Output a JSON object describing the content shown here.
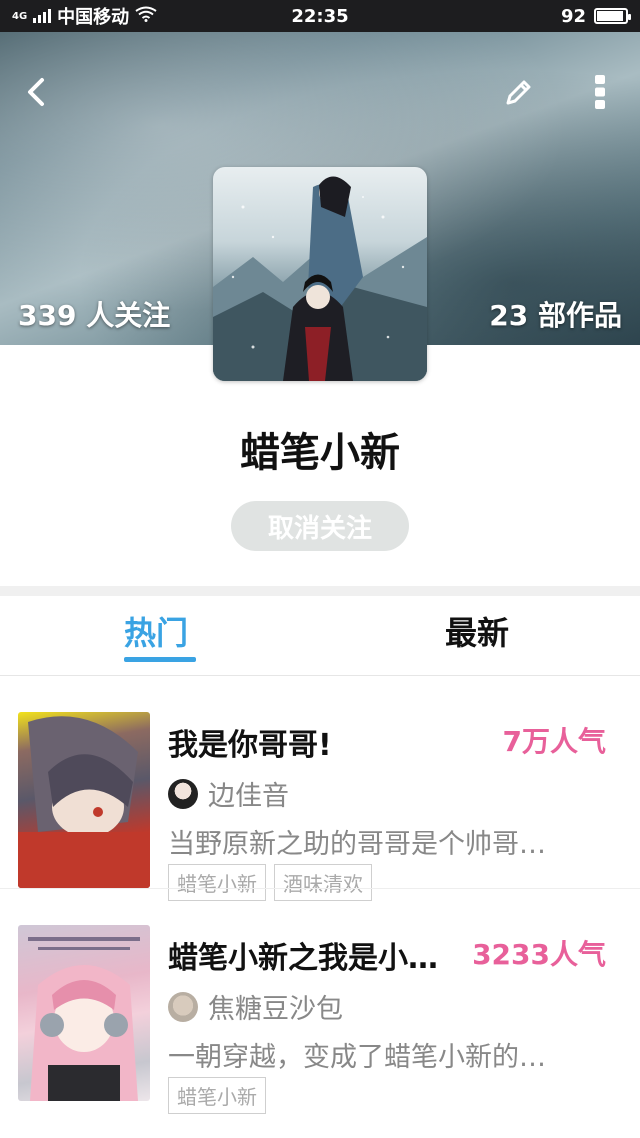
{
  "status_bar": {
    "carrier": "中国移动",
    "network": "4G",
    "time": "22:35",
    "battery": "92"
  },
  "header": {
    "followers_label": "339 人关注",
    "works_label": "23 部作品",
    "back_icon": "chevron-left-icon",
    "edit_icon": "pencil-icon",
    "more_icon": "more-vertical-icon"
  },
  "author": {
    "name": "蜡笔小新",
    "unfollow_label": "取消关注"
  },
  "tabs": [
    {
      "label": "热门",
      "active": true
    },
    {
      "label": "最新",
      "active": false
    }
  ],
  "colors": {
    "accent": "#3aa3e3",
    "popularity": "#e8609a"
  },
  "works": [
    {
      "title": "我是你哥哥!",
      "popularity": "7万人气",
      "user": "边佳音",
      "description": "当野原新之助的哥哥是个帅哥…",
      "tags": [
        "蜡笔小新",
        "酒味清欢"
      ]
    },
    {
      "title": "蜡笔小新之我是小…",
      "popularity": "3233人气",
      "user": "焦糖豆沙包",
      "description": "一朝穿越，变成了蜡笔小新的…",
      "tags": [
        "蜡笔小新"
      ]
    }
  ]
}
